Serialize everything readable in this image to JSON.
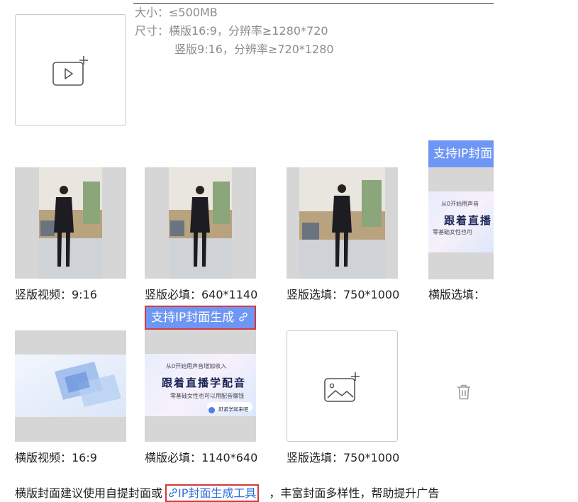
{
  "requirements": {
    "size": "大小：≤500MB",
    "dimension": "尺寸：横版16:9，分辨率≥1280*720",
    "dimension_portrait": "竖版9:16，分辨率≥720*1280"
  },
  "row1": [
    {
      "label": "竖版视频：9:16"
    },
    {
      "label": "竖版必填：640*1140"
    },
    {
      "label": "竖版选填：750*1000"
    },
    {
      "label": "横版选填："
    }
  ],
  "row2": [
    {
      "label": "横版视频：16:9"
    },
    {
      "label": "横版必填：1140*640"
    },
    {
      "label": "竖版选填：750*1000"
    }
  ],
  "ip_badge_short": "支持IP封面",
  "ip_badge_full": "支持IP封面生成",
  "banner": {
    "sub1": "从0开始用声音增加收入",
    "title": "跟着直播学配音",
    "sub2": "零基础女性也可以用配音赚钱",
    "button": "赶紧学起来吧",
    "sub1_short": "从0开始用声音",
    "title_short": "跟着直播",
    "sub2_short": "零基础女性也可"
  },
  "bottom": {
    "prefix": "横版封面建议使用自提封面或",
    "link": "IP封面生成工具",
    "suffix": "，丰富封面多样性，帮助提升广告"
  },
  "colors": {
    "accent": "#6e96f4",
    "link": "#2d6fd8",
    "highlight": "#d63a3a"
  }
}
